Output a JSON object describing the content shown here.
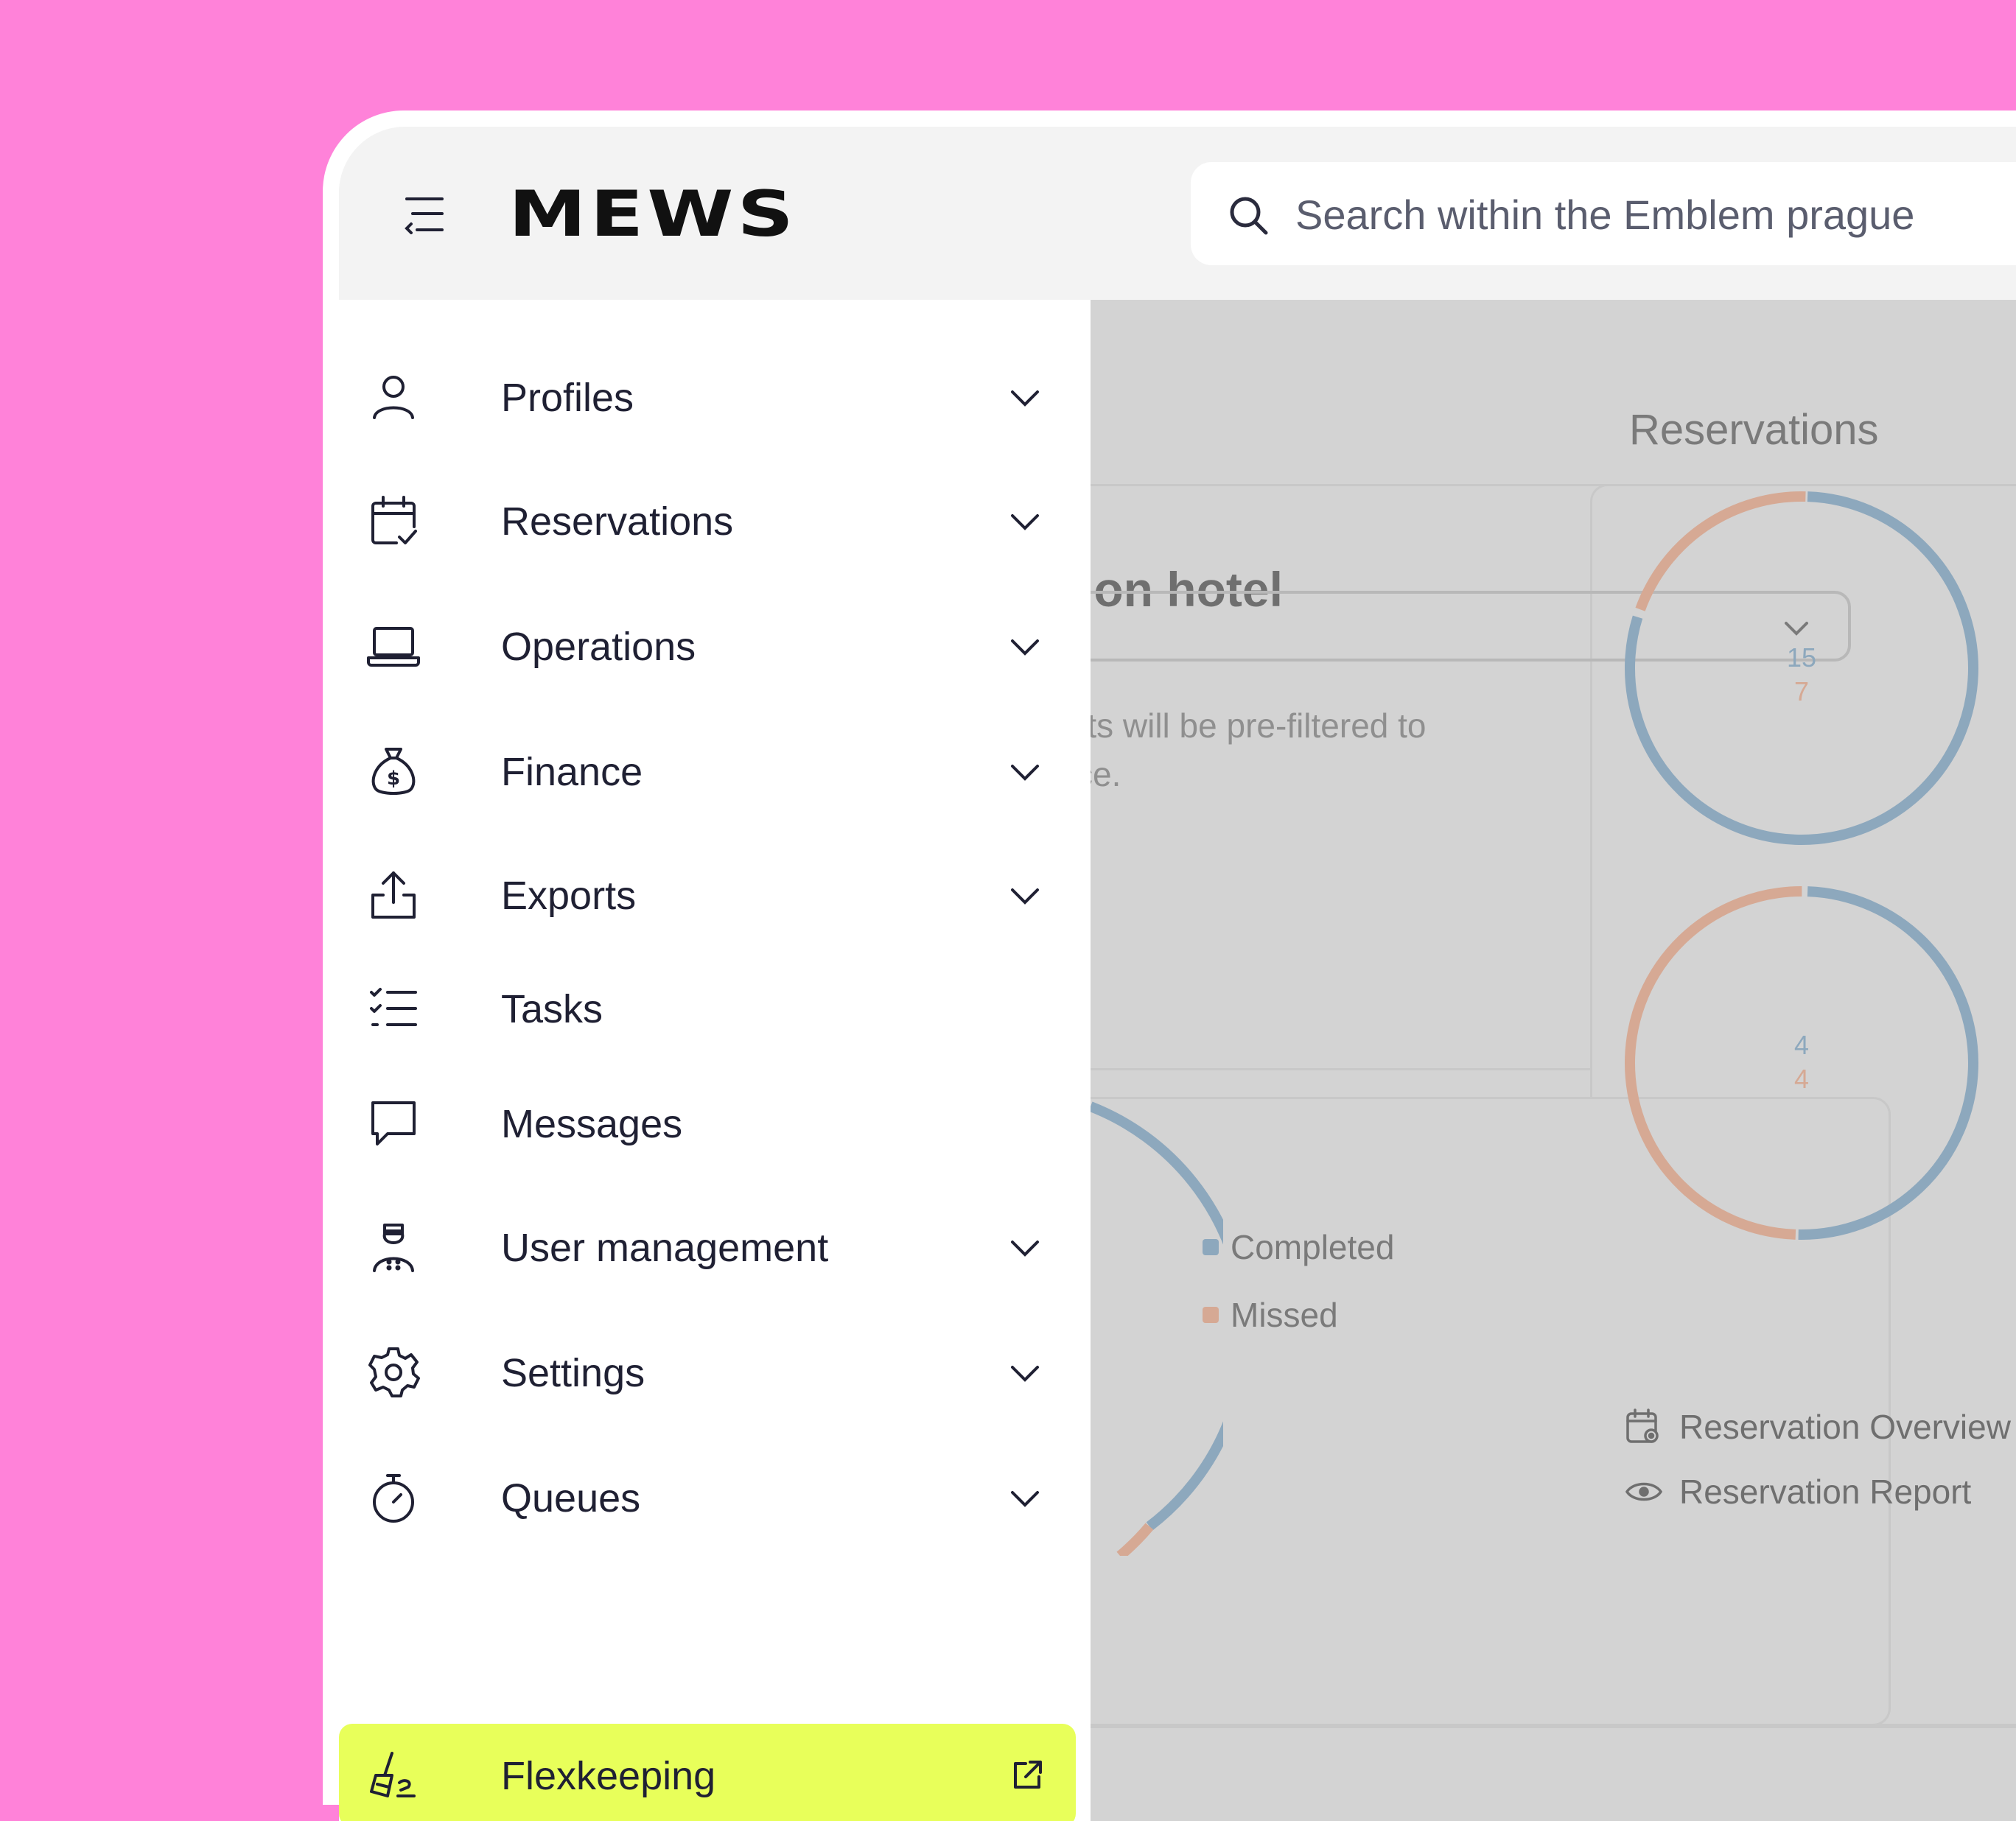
{
  "header": {
    "logo_text": "MEWS",
    "search_placeholder": "Search within the Emblem prague"
  },
  "colors": {
    "background": "#FF82D9",
    "highlight": "#E8FF5A",
    "series_blue": "#8DA8BD",
    "series_orange": "#D6A994"
  },
  "dimmed_content": {
    "card1_title": "ion hotel",
    "helper_line1": "rts will be pre-filtered to",
    "helper_line2": "ce.",
    "legend": [
      {
        "label": "Completed",
        "color": "#8DA8BD"
      },
      {
        "label": "Missed",
        "color": "#D6A994"
      }
    ],
    "reservations_title": "Reservations",
    "donut1": {
      "value_a": "15",
      "value_b": "7"
    },
    "donut2": {
      "value_a": "4",
      "value_b": "4"
    },
    "links": [
      {
        "label": "Reservation Overview",
        "icon": "calendar-eye-icon"
      },
      {
        "label": "Reservation Report",
        "icon": "eye-icon"
      }
    ]
  },
  "sidebar": {
    "items": [
      {
        "label": "Profiles",
        "icon": "user-icon",
        "expandable": true
      },
      {
        "label": "Reservations",
        "icon": "calendar-check-icon",
        "expandable": true
      },
      {
        "label": "Operations",
        "icon": "laptop-icon",
        "expandable": true
      },
      {
        "label": "Finance",
        "icon": "money-bag-icon",
        "expandable": true
      },
      {
        "label": "Exports",
        "icon": "upload-icon",
        "expandable": true
      },
      {
        "label": "Tasks",
        "icon": "checklist-icon",
        "expandable": false
      },
      {
        "label": "Messages",
        "icon": "chat-bubble-icon",
        "expandable": false
      },
      {
        "label": "User management",
        "icon": "bellhop-icon",
        "expandable": true
      },
      {
        "label": "Settings",
        "icon": "gear-icon",
        "expandable": true
      },
      {
        "label": "Queues",
        "icon": "stopwatch-icon",
        "expandable": true
      },
      {
        "label": "Flexkeeping",
        "icon": "broom-icon",
        "expandable": false,
        "external": true,
        "active": true
      }
    ]
  }
}
